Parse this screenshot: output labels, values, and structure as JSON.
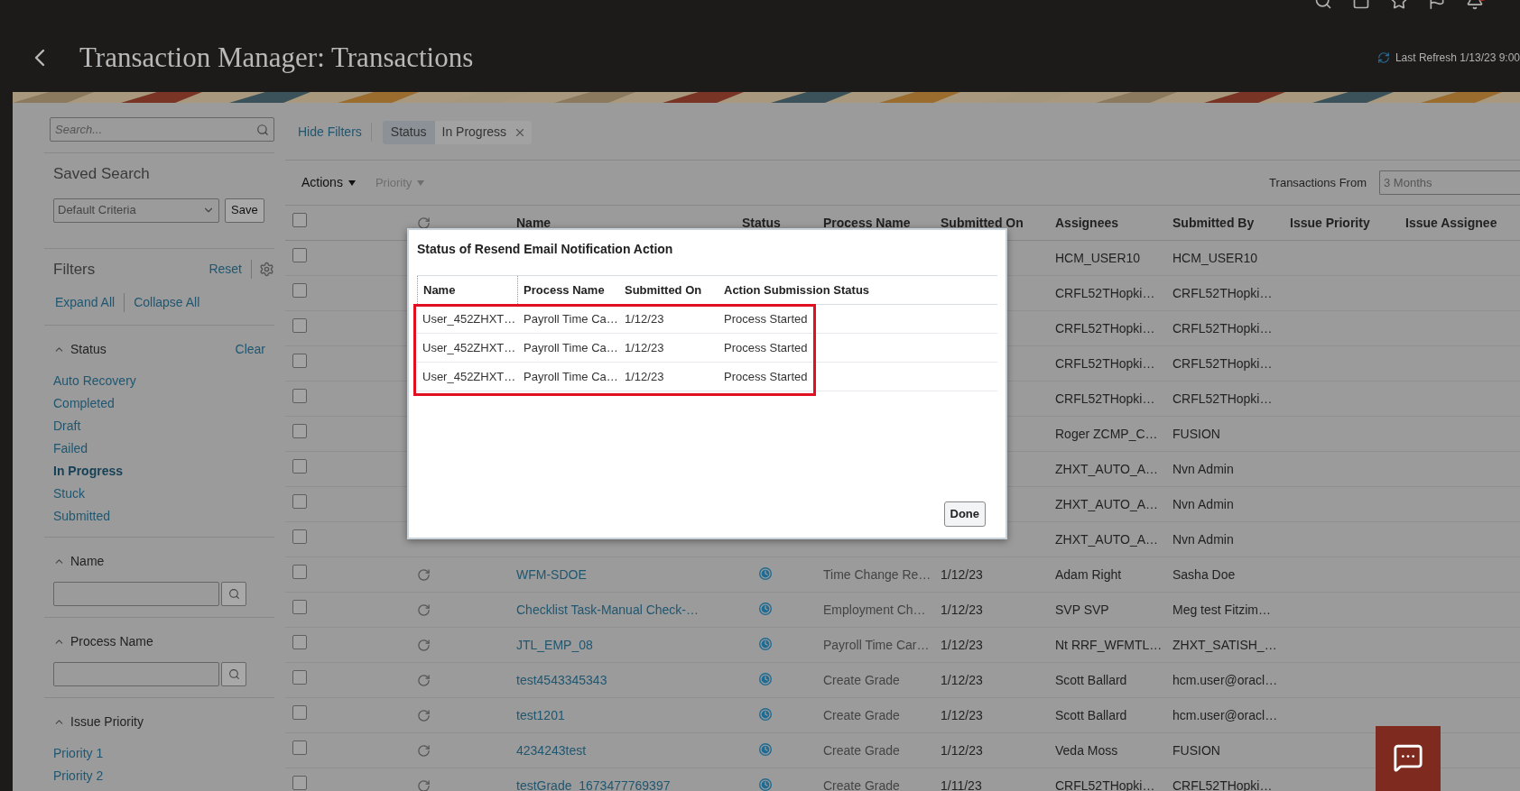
{
  "header": {
    "title": "Transaction Manager: Transactions",
    "last_refresh": "Last Refresh 1/13/23 9:00"
  },
  "sidebar": {
    "search_placeholder": "Search...",
    "saved_search_title": "Saved Search",
    "saved_search_value": "Default Criteria",
    "save_button": "Save",
    "filters_title": "Filters",
    "reset": "Reset",
    "expand_all": "Expand All",
    "collapse_all": "Collapse All",
    "sections": [
      {
        "kind": "links",
        "title": "Status",
        "expanded": true,
        "action": "Clear",
        "items": [
          {
            "label": "Auto Recovery",
            "selected": false
          },
          {
            "label": "Completed",
            "selected": false
          },
          {
            "label": "Draft",
            "selected": false
          },
          {
            "label": "Failed",
            "selected": false
          },
          {
            "label": "In Progress",
            "selected": true
          },
          {
            "label": "Stuck",
            "selected": false
          },
          {
            "label": "Submitted",
            "selected": false
          }
        ]
      },
      {
        "kind": "search",
        "title": "Name",
        "expanded": true
      },
      {
        "kind": "search",
        "title": "Process Name",
        "expanded": true
      },
      {
        "kind": "links",
        "title": "Issue Priority",
        "expanded": true,
        "items": [
          {
            "label": "Priority 1",
            "selected": false
          },
          {
            "label": "Priority 2",
            "selected": false
          }
        ]
      }
    ]
  },
  "filter_bar": {
    "hide_filters": "Hide Filters",
    "chips": [
      {
        "label": "Status",
        "value": "In Progress"
      }
    ]
  },
  "toolbar": {
    "actions": "Actions",
    "priority": "Priority",
    "priority_disabled": true,
    "transactions_from_label": "Transactions From",
    "transactions_from_value": "3 Months"
  },
  "table": {
    "header_checked": false,
    "columns": [
      "Name",
      "Status",
      "Process Name",
      "Submitted On",
      "Assignees",
      "Submitted By",
      "Issue Priority",
      "Issue Assignee"
    ],
    "rows": [
      {
        "checked": false,
        "assignees": "HCM_USER10",
        "submitted_by": "HCM_USER10"
      },
      {
        "checked": false,
        "assignees": "CRFL52THopki…",
        "submitted_by": "CRFL52THopki…"
      },
      {
        "checked": false,
        "assignees": "CRFL52THopki…",
        "submitted_by": "CRFL52THopki…"
      },
      {
        "checked": false,
        "assignees": "CRFL52THopki…",
        "submitted_by": "CRFL52THopki…"
      },
      {
        "checked": false,
        "assignees": "CRFL52THopki…",
        "submitted_by": "CRFL52THopki…"
      },
      {
        "checked": false,
        "assignees": "Roger ZCMP_C…",
        "submitted_by": "FUSION"
      },
      {
        "checked": false,
        "assignees": "ZHXT_AUTO_A…",
        "submitted_by": "Nvn Admin"
      },
      {
        "checked": false,
        "assignees": "ZHXT_AUTO_A…",
        "submitted_by": "Nvn Admin"
      },
      {
        "checked": false,
        "assignees": "ZHXT_AUTO_A…",
        "submitted_by": "Nvn Admin"
      },
      {
        "checked": false,
        "name": "WFM-SDOE",
        "kind": "in_progress",
        "process_name": "Time Change Re…",
        "submitted_on": "1/12/23",
        "assignees": "Adam Right",
        "submitted_by": "Sasha Doe"
      },
      {
        "checked": false,
        "name": "Checklist Task-Manual Check-…",
        "kind": "in_progress",
        "process_name": "Employment Ch…",
        "submitted_on": "1/12/23",
        "assignees": "SVP SVP",
        "submitted_by": "Meg test Fitzim…"
      },
      {
        "checked": false,
        "name": "JTL_EMP_08",
        "kind": "in_progress",
        "process_name": "Payroll Time Car…",
        "submitted_on": "1/12/23",
        "assignees": "Nt RRF_WFMTL…",
        "submitted_by": "ZHXT_SATISH_…"
      },
      {
        "checked": false,
        "name": "test4543345343",
        "kind": "in_progress",
        "process_name": "Create Grade",
        "submitted_on": "1/12/23",
        "assignees": "Scott Ballard",
        "submitted_by": "hcm.user@oracl…"
      },
      {
        "checked": false,
        "name": "test1201",
        "kind": "in_progress",
        "process_name": "Create Grade",
        "submitted_on": "1/12/23",
        "assignees": "Scott Ballard",
        "submitted_by": "hcm.user@oracl…"
      },
      {
        "checked": false,
        "name": "4234243test",
        "kind": "in_progress",
        "process_name": "Create Grade",
        "submitted_on": "1/12/23",
        "assignees": "Veda Moss",
        "submitted_by": "FUSION"
      },
      {
        "checked": false,
        "name": "testGrade_1673477769397",
        "kind": "in_progress",
        "process_name": "Create Grade",
        "submitted_on": "1/11/23",
        "assignees": "CRFL52THopki…",
        "submitted_by": "CRFL52THopki…"
      }
    ]
  },
  "dialog": {
    "title": "Status of Resend Email Notification Action",
    "columns": [
      "Name",
      "Process Name",
      "Submitted On",
      "Action Submission Status"
    ],
    "rows": [
      [
        "User_452ZHXT…",
        "Payroll Time Ca…",
        "1/12/23",
        "Process Started"
      ],
      [
        "User_452ZHXT…",
        "Payroll Time Ca…",
        "1/12/23",
        "Process Started"
      ],
      [
        "User_452ZHXT…",
        "Payroll Time Ca…",
        "1/12/23",
        "Process Started"
      ]
    ],
    "done": "Done"
  }
}
